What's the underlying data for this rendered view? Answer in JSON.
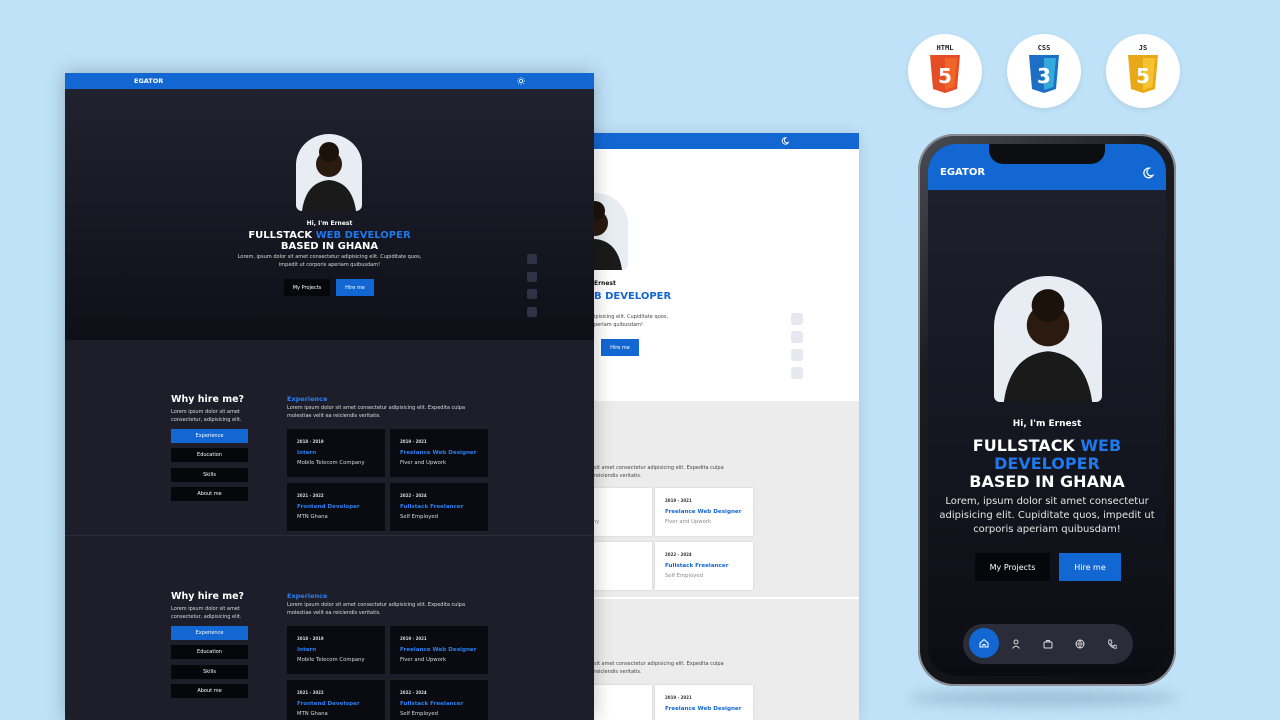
{
  "brand": "EGATOR",
  "hero": {
    "greeting": "Hi, I'm Ernest",
    "title_part1": "FULLSTACK ",
    "title_highlight": "WEB DEVELOPER",
    "title_line2": "BASED IN GHANA",
    "phone_title_highlight_1": "WEB",
    "phone_title_highlight_2": "DEVELOPER",
    "phone_title_part1": "FULLSTACK ",
    "desc_line1": "Lorem, ipsum dolor sit amet consectetur adipisicing elit. Cupiditate quos,",
    "desc_line2": "impedit ut corporis aperiam quibusdam!",
    "phone_desc_1": "Lorem, ipsum dolor sit amet consectetur",
    "phone_desc_2": "adipisicing elit. Cupiditate quos, impedit ut",
    "phone_desc_3": "corporis aperiam quibusdam!",
    "light_title_1": "B DEVELOPER",
    "light_greet": "Ernest",
    "light_desc_1": "ipisicing elit. Cupiditate quos,",
    "light_desc_2": "perlam quibusdam!",
    "btn_projects": "My Projects",
    "btn_hire": "Hire me"
  },
  "about": {
    "heading": "Why hire me?",
    "sub_line1": "Lorem ipsum dolor sit amet",
    "sub_line2": "consectetur, adipisicing elit.",
    "tabs": [
      "Experience",
      "Education",
      "Skills",
      "About me"
    ],
    "section_title": "Experience",
    "section_desc_1": "Lorem ipsum dolor sit amet consectetur adipisicing elit. Expedita culpa",
    "section_desc_2": "molestiae velit ea reiciendis veritatis.",
    "light_desc_1": "sit amet consectetur adipisicing elit. Expedita culpa",
    "light_desc_2": "reiciendis veritatis.",
    "cards": [
      {
        "years": "2018 - 2019",
        "title": "Intern",
        "company": "Mobile Telecom Company"
      },
      {
        "years": "2019 - 2021",
        "title": "Freelance Web Designer",
        "company": "Fiver and Upwork"
      },
      {
        "years": "2021 - 2022",
        "title": "Frontend Developer",
        "company": "MTN Ghana"
      },
      {
        "years": "2022 - 2024",
        "title": "Fullstack Freelancer",
        "company": "Self Employed"
      }
    ],
    "light_partial": [
      "om Company",
      "eveloper"
    ]
  },
  "badges": [
    {
      "label": "HTML",
      "num": "5",
      "color": "#e44d26"
    },
    {
      "label": "CSS",
      "num": "3",
      "color": "#1c6fc4"
    },
    {
      "label": "JS",
      "num": "5",
      "color": "#e8a817"
    }
  ],
  "icons": {
    "theme_dark": "sun-icon",
    "theme_light": "moon-icon",
    "nav": [
      "home-icon",
      "user-icon",
      "briefcase-icon",
      "globe-icon",
      "phone-icon"
    ]
  },
  "colors": {
    "accent": "#1367d3",
    "dark_bg": "#1d1e2a",
    "page_bg": "#bfe2f8"
  }
}
